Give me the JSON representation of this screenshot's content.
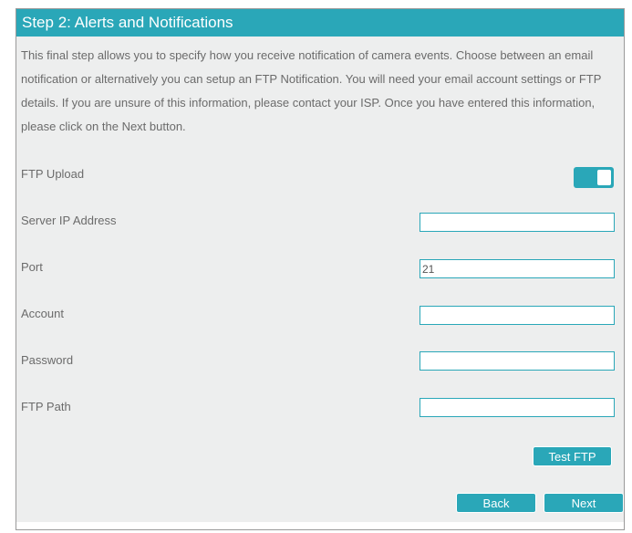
{
  "header": {
    "title": "Step 2: Alerts and Notifications"
  },
  "intro": "This final step allows you to specify how you receive notification of camera events. Choose between an email notification or alternatively you can setup an FTP Notification. You will need your email account settings or FTP details. If you are unsure of this information, please contact your ISP. Once you have entered this information, please click on the Next button.",
  "ftp_upload": {
    "label": "FTP Upload",
    "enabled": true
  },
  "fields": {
    "server_ip": {
      "label": "Server IP Address",
      "value": ""
    },
    "port": {
      "label": "Port",
      "value": "21"
    },
    "account": {
      "label": "Account",
      "value": ""
    },
    "password": {
      "label": "Password",
      "value": ""
    },
    "ftp_path": {
      "label": "FTP Path",
      "value": ""
    }
  },
  "buttons": {
    "test_ftp": "Test FTP",
    "back": "Back",
    "next": "Next"
  },
  "colors": {
    "accent": "#2aa7b8",
    "panel_bg": "#edeeee",
    "text": "#6b6b6b"
  }
}
